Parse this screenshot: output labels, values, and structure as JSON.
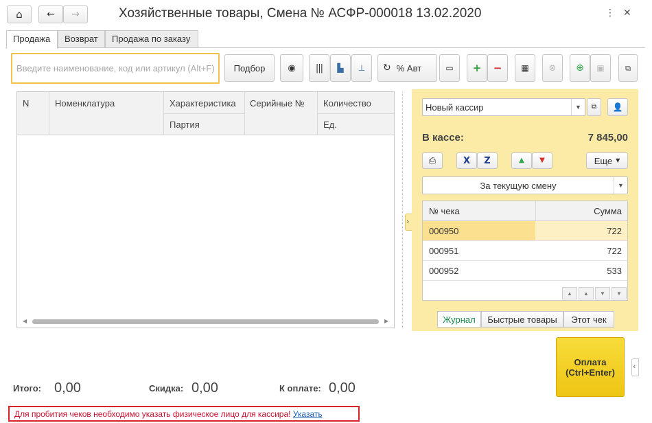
{
  "window": {
    "title": "Хозяйственные товары, Смена № АСФР-000018  13.02.2020"
  },
  "tabs": [
    {
      "label": "Продажа",
      "active": true
    },
    {
      "label": "Возврат",
      "active": false
    },
    {
      "label": "Продажа по заказу",
      "active": false
    }
  ],
  "search": {
    "placeholder": "Введите наименование, код или артикул (Alt+F)",
    "value": ""
  },
  "toolbar": {
    "podbor_label": "Подбор",
    "discount_label": "% Авт"
  },
  "items_table": {
    "headers": {
      "n": "N",
      "nomenclature": "Номенклатура",
      "characteristic": "Характеристика",
      "serial": "Серийные №",
      "quantity": "Количество",
      "batch": "Партия",
      "unit": "Ед."
    },
    "rows": []
  },
  "cashier": {
    "selected": "Новый кассир",
    "in_cash_label": "В кассе:",
    "in_cash_value": "7 845,00",
    "more_label": "Еще",
    "period_selected": "За текущую смену"
  },
  "receipts": {
    "headers": {
      "number": "№ чека",
      "sum": "Сумма"
    },
    "rows": [
      {
        "number": "000950",
        "sum": "722",
        "selected": true
      },
      {
        "number": "000951",
        "sum": "722",
        "selected": false
      },
      {
        "number": "000952",
        "sum": "533",
        "selected": false
      }
    ]
  },
  "panel_tabs": [
    {
      "label": "Журнал",
      "active": true
    },
    {
      "label": "Быстрые товары",
      "active": false
    },
    {
      "label": "Этот чек",
      "active": false
    }
  ],
  "payment": {
    "line1": "Оплата",
    "line2": "(Ctrl+Enter)"
  },
  "totals": {
    "total_label": "Итого:",
    "total_value": "0,00",
    "discount_label": "Скидка:",
    "discount_value": "0,00",
    "to_pay_label": "К оплате:",
    "to_pay_value": "0,00"
  },
  "warning": {
    "text": "Для пробития чеков необходимо указать физическое лицо для кассира!",
    "link": "Указать"
  },
  "colors": {
    "accent_yellow": "#fbeba6",
    "pay_button": "#f3cf27",
    "warning_border": "#d8232a",
    "selected_row": "#fbe08f"
  }
}
